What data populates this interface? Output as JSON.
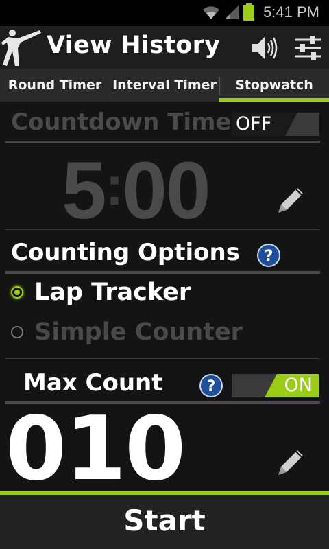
{
  "status_bar": {
    "time": "5:41 PM",
    "icons": [
      "wifi-icon",
      "signal-icon",
      "battery-icon"
    ]
  },
  "action_bar": {
    "title": "View History",
    "icons": [
      "app-logo-icon",
      "sound-icon",
      "settings-icon"
    ]
  },
  "tabs": [
    {
      "label": "Round Timer",
      "active": false
    },
    {
      "label": "Interval Timer",
      "active": false
    },
    {
      "label": "Stopwatch",
      "active": true
    }
  ],
  "countdown": {
    "label": "Countdown Timer",
    "toggle": "OFF",
    "time_minutes": "5",
    "time_seconds": "00"
  },
  "counting_options": {
    "label": "Counting Options",
    "options": [
      {
        "label": "Lap Tracker",
        "selected": true
      },
      {
        "label": "Simple Counter",
        "selected": false
      }
    ]
  },
  "max_count": {
    "label": "Max Count",
    "toggle": "ON",
    "value": "010"
  },
  "start_button": {
    "label": "Start"
  },
  "colors": {
    "accent": "#9bcc16",
    "background": "#141414",
    "disabled_text": "#4a4a4a"
  }
}
